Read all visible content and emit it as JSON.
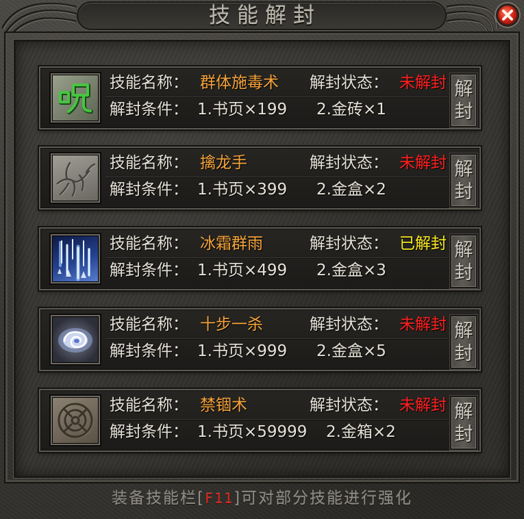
{
  "window": {
    "title": "技能解封",
    "close_icon": "close-icon"
  },
  "labels": {
    "skill_name": "技能名称：",
    "unseal_status": "解封状态：",
    "unseal_condition": "解封条件：",
    "unseal_button": "解封"
  },
  "skills": [
    {
      "icon": "poison-rune-icon",
      "name": "群体施毒术",
      "status": "未解封",
      "status_color": "#ff1f1f",
      "condition_1": "1.书页×199",
      "condition_2": "2.金砖×1"
    },
    {
      "icon": "dragon-claw-icon",
      "name": "擒龙手",
      "status": "未解封",
      "status_color": "#ff1f1f",
      "condition_1": "1.书页×399",
      "condition_2": "2.金盒×2"
    },
    {
      "icon": "ice-rain-icon",
      "name": "冰霜群雨",
      "status": "已解封",
      "status_color": "#f7e81f",
      "condition_1": "1.书页×499",
      "condition_2": "2.金盒×3"
    },
    {
      "icon": "vortex-icon",
      "name": "十步一杀",
      "status": "未解封",
      "status_color": "#ff1f1f",
      "condition_1": "1.书页×999",
      "condition_2": "2.金盒×5"
    },
    {
      "icon": "seal-circle-icon",
      "name": "禁锢术",
      "status": "未解封",
      "status_color": "#ff1f1f",
      "condition_1": "1.书页×59999",
      "condition_2": "2.金箱×2"
    }
  ],
  "footer": {
    "prefix": "装备技能栏[",
    "hotkey": "F11",
    "suffix": "]可对部分技能进行强化"
  },
  "colors": {
    "label": "#e6e2d8",
    "skill_name": "#f4a23a",
    "status_locked": "#ff1f1f",
    "status_unlocked": "#f7e81f",
    "hotkey": "#e0261c",
    "title": "#bab6ab",
    "close_button": "#d62818"
  }
}
